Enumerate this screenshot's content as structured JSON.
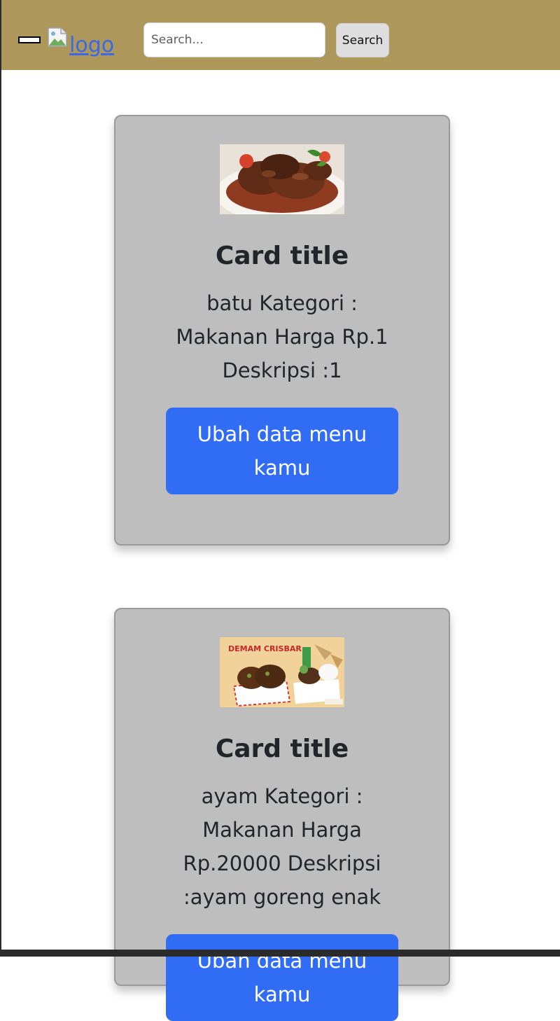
{
  "header": {
    "logo_alt_text": "logo",
    "search": {
      "placeholder": "Search...",
      "value": ""
    },
    "search_button_label": "Search"
  },
  "cards": [
    {
      "title": "Card title",
      "text": "batu Kategori : Makanan Harga Rp.1 Deskripsi :1",
      "button_label": "Ubah data menu kamu"
    },
    {
      "title": "Card title",
      "text": "ayam Kategori : Makanan Harga Rp.20000 Deskripsi :ayam goreng enak",
      "button_label": "Ubah data menu kamu",
      "image_text": "DEMAM CRISBAR"
    }
  ],
  "colors": {
    "navbar": "#ad975b",
    "card_background": "#bebebe",
    "primary_button": "#316cf4",
    "link": "#3a69e8"
  },
  "icons": [
    "hamburger-menu-icon",
    "broken-image-icon"
  ]
}
